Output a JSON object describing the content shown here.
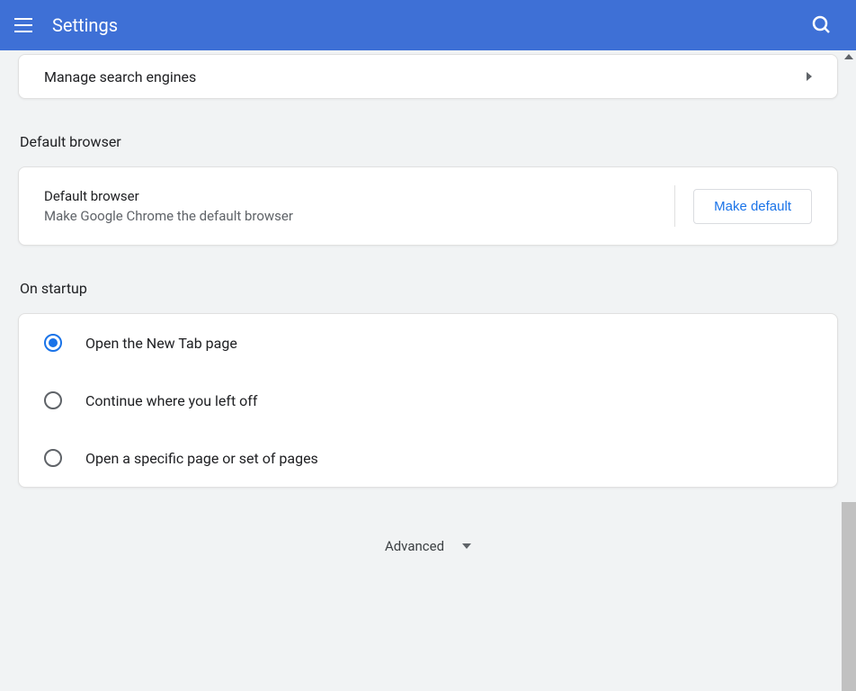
{
  "header": {
    "title": "Settings"
  },
  "searchEngine": {
    "manage_label": "Manage search engines"
  },
  "defaultBrowser": {
    "section_title": "Default browser",
    "row_title": "Default browser",
    "row_sub": "Make Google Chrome the default browser",
    "button_label": "Make default"
  },
  "startup": {
    "section_title": "On startup",
    "options": {
      "new_tab": "Open the New Tab page",
      "continue": "Continue where you left off",
      "specific": "Open a specific page or set of pages"
    }
  },
  "advanced": {
    "label": "Advanced"
  }
}
